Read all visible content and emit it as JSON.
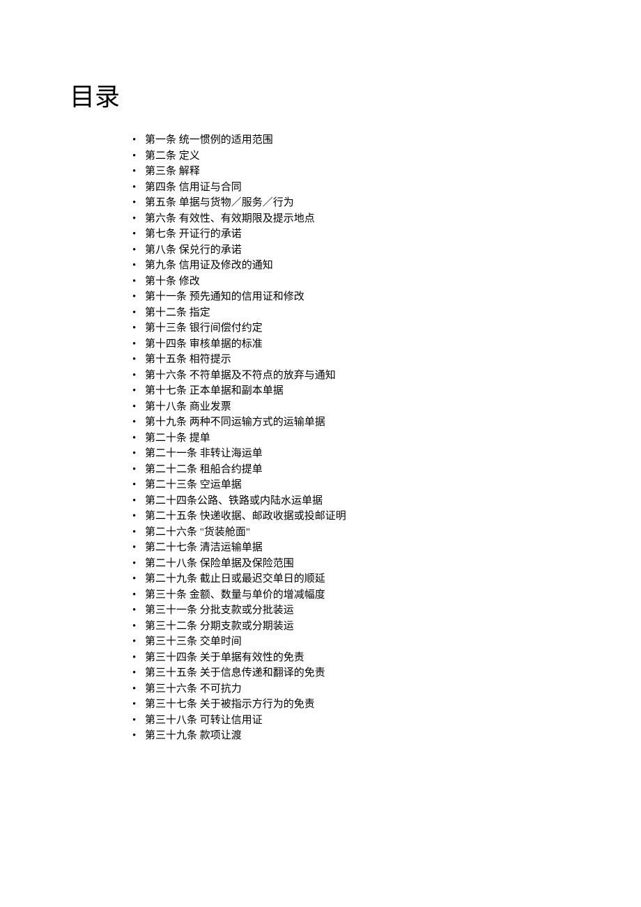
{
  "title": "目录",
  "toc": {
    "items": [
      "第一条  统一惯例的适用范围",
      "第二条  定义",
      "第三条  解释",
      "第四条  信用证与合同",
      "第五条  单据与货物／服务／行为",
      "第六条  有效性、有效期限及提示地点",
      "第七条  开证行的承诺",
      "第八条  保兑行的承诺",
      "第九条  信用证及修改的通知",
      "第十条  修改",
      "第十一条  预先通知的信用证和修改",
      "第十二条  指定",
      "第十三条  银行间偿付约定",
      "第十四条  审核单据的标准",
      "第十五条  相符提示",
      "第十六条  不符单据及不符点的放弃与通知",
      "第十七条  正本单据和副本单据",
      "第十八条  商业发票",
      "第十九条  两种不同运输方式的运输单据",
      "第二十条  提单",
      "第二十一条  非转让海运单",
      "第二十二条  租船合约提单",
      "第二十三条  空运单据",
      "第二十四条公路、铁路或内陆水运单据",
      "第二十五条  快递收据、邮政收据或投邮证明",
      "第二十六条  \"货装舱面\"",
      "第二十七条  清洁运输单据",
      "第二十八条  保险单据及保险范围",
      "第二十九条  截止日或最迟交单日的顺延",
      "第三十条  金额、数量与单价的增减幅度",
      "第三十一条  分批支款或分批装运",
      "第三十二条  分期支款或分期装运",
      "第三十三条  交单时间",
      "第三十四条  关于单据有效性的免责",
      "第三十五条  关于信息传递和翻译的免责",
      "第三十六条  不可抗力",
      "第三十七条  关于被指示方行为的免责",
      "第三十八条  可转让信用证",
      "第三十九条  款项让渡"
    ]
  }
}
